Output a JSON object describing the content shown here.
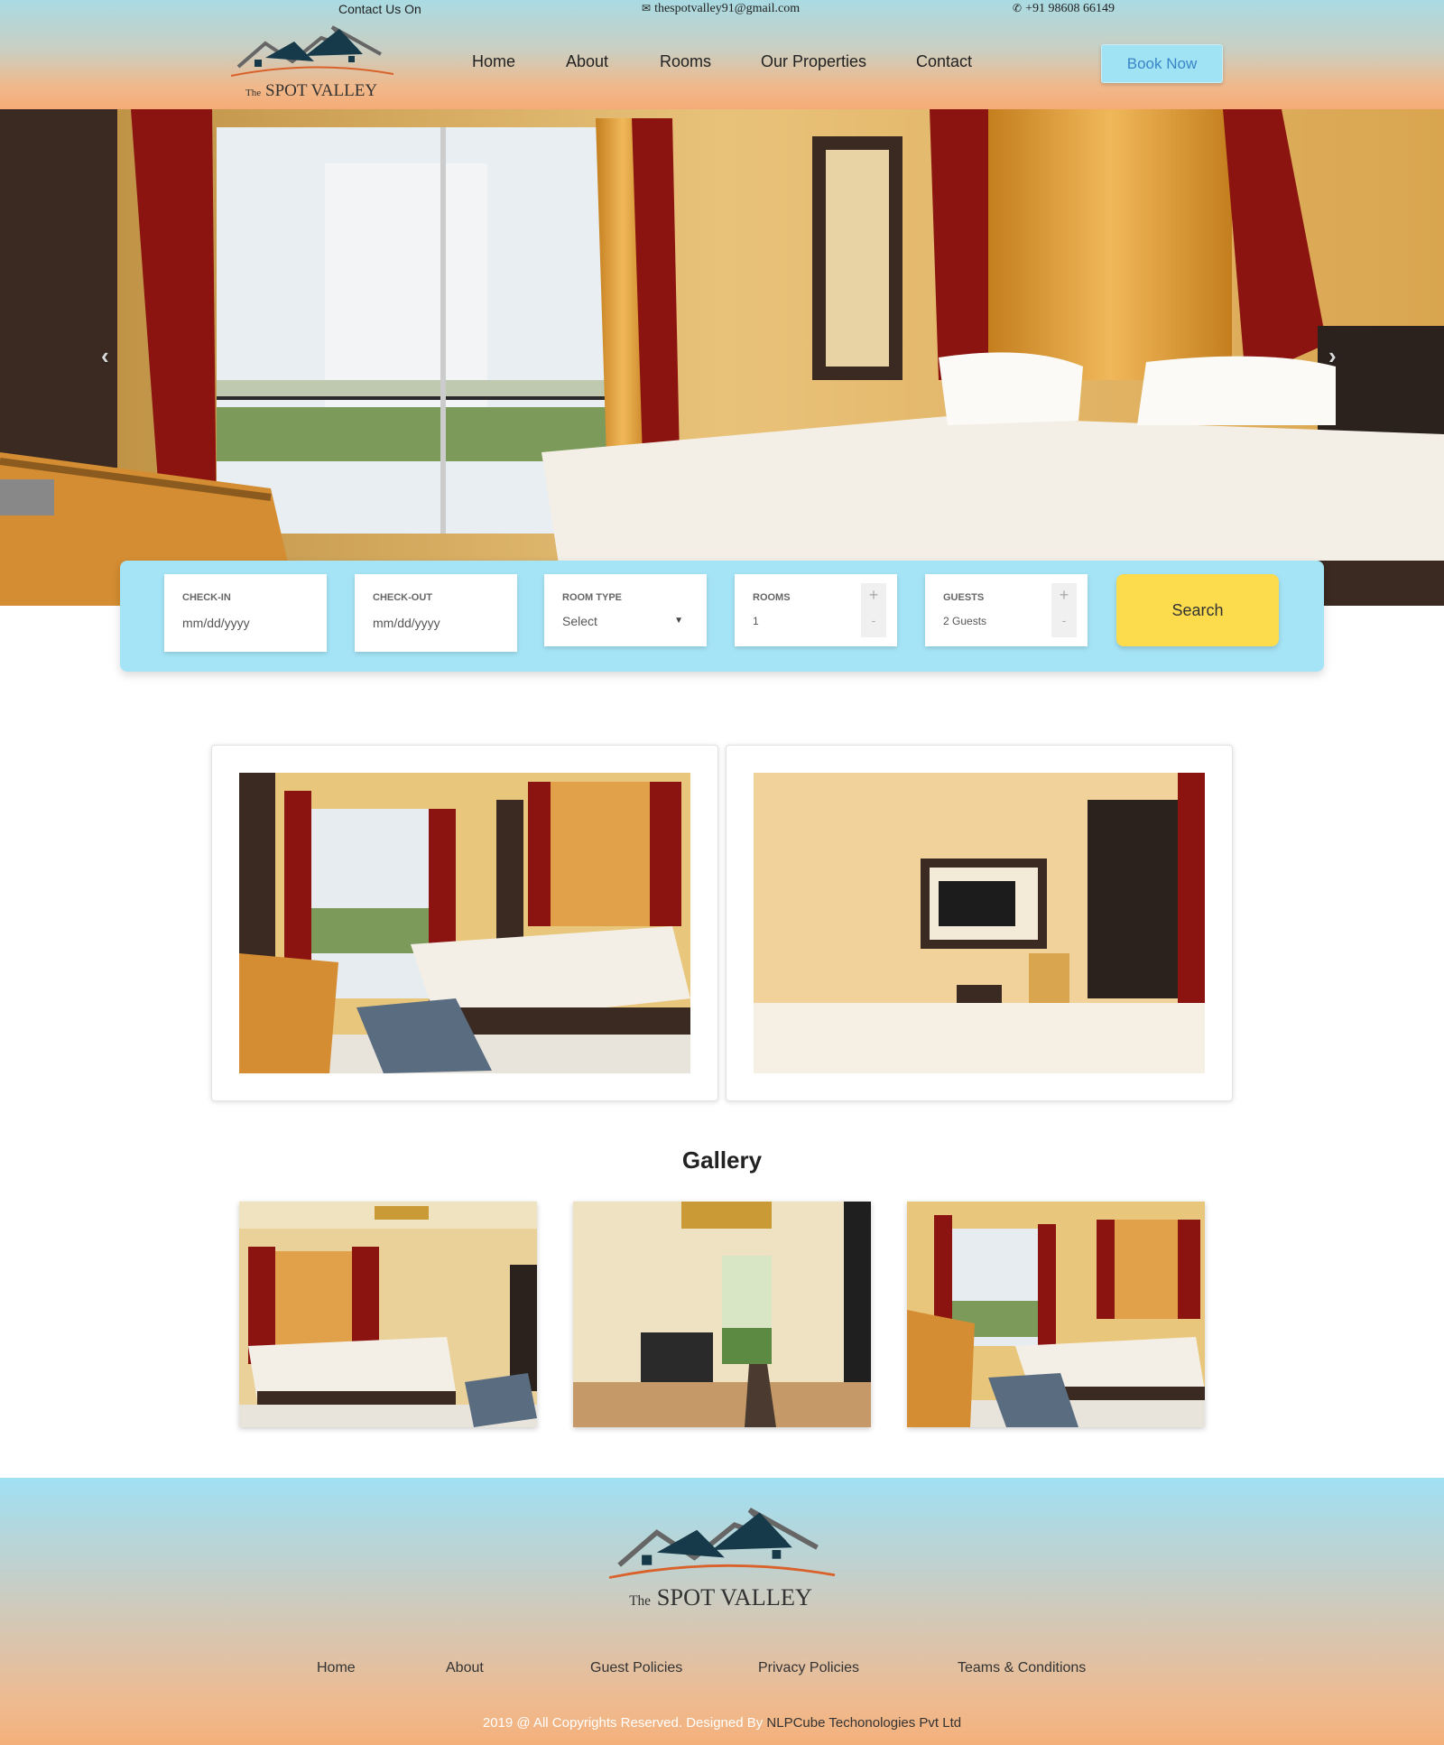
{
  "topbar": {
    "contact_label": "Contact Us On",
    "email": "thespotvalley91@gmail.com",
    "phone": "+91 98608 66149",
    "email_icon": "envelope-icon",
    "phone_icon": "phone-icon"
  },
  "brand": {
    "logo_small": "The",
    "logo_name": "SPOT VALLEY"
  },
  "nav": {
    "items": [
      "Home",
      "About",
      "Rooms",
      "Our Properties",
      "Contact"
    ],
    "book_now": "Book Now"
  },
  "hero": {
    "prev_icon": "chevron-left-icon",
    "next_icon": "chevron-right-icon"
  },
  "booking": {
    "checkin_label": "CHECK-IN",
    "checkin_placeholder": "mm/dd/yyyy",
    "checkout_label": "CHECK-OUT",
    "checkout_placeholder": "mm/dd/yyyy",
    "room_type_label": "ROOM TYPE",
    "room_type_value": "Select",
    "rooms_label": "ROOMS",
    "rooms_value": "1",
    "guests_label": "GUESTS",
    "guests_value": "2 Guests",
    "plus": "+",
    "minus": "-",
    "search_label": "Search"
  },
  "gallery": {
    "title": "Gallery"
  },
  "footer": {
    "links": [
      "Home",
      "About",
      "Guest Policies",
      "Privacy Policies",
      "Teams & Conditions"
    ],
    "copyright_prefix": "2019 @ All Copyrights Reserved. Designed By ",
    "company": "NLPCube Techonologies Pvt Ltd"
  },
  "colors": {
    "accent_blue": "#a5e4f6",
    "search_yellow": "#fcdc4d",
    "header_peach": "#f5ab77"
  }
}
